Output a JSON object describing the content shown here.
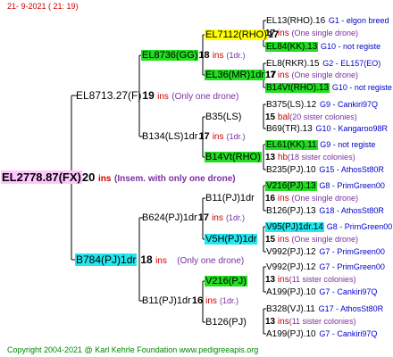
{
  "header": "21-  9-2021 ( 21: 19)",
  "copyright": "Copyright 2004-2021 @ Karl Kehrle Foundation    www.pedigreeapis.org",
  "colors": {
    "green": "#22dd22",
    "yellow": "#ffff00",
    "pink": "#ffc6ff",
    "cyan": "#22e6f0",
    "red": "#cc0000",
    "blue": "#0000cc",
    "purple": "#7b2fa0"
  },
  "root": {
    "name": "EL2778.87(FX)",
    "num": "20",
    "ins": "ins",
    "note": "(Insem. with only one drone)"
  },
  "parents": {
    "dam": {
      "name": "EL8713.27(F)",
      "num": "19",
      "ins": "ins",
      "note": "(Only one drone)"
    },
    "sire": {
      "name": "B784(PJ)1dr",
      "num": "18",
      "ins": "ins",
      "note": "(Only one drone)"
    }
  },
  "grandparents": [
    {
      "name": "EL8736(GG)",
      "num": "18",
      "ins": "ins",
      "note": "(1dr.)"
    },
    {
      "name": "B134(LS)1dr",
      "num": "17",
      "ins": "ins",
      "note": "(1dr.)"
    },
    {
      "name": "B624(PJ)1dr",
      "num": "17",
      "ins": "ins",
      "note": "(1dr.)"
    },
    {
      "name": "B11(PJ)1dr",
      "num": "16",
      "ins": "ins",
      "note": "(1dr.)"
    }
  ],
  "level3": [
    {
      "name": "EL7112(RHO)",
      "num": "17",
      "ins": "ins",
      "note": "(One single drone)"
    },
    {
      "name": "EL36(MR)1dr",
      "num": "17",
      "ins": "ins",
      "note": "(One single drone)"
    },
    {
      "name": "B35(LS)",
      "num": "",
      "ins": "",
      "note": ""
    },
    {
      "name": "B14Vt(RHO)",
      "num": "",
      "ins": "",
      "note": ""
    },
    {
      "name": "B11(PJ)1dr",
      "num": "",
      "ins": "",
      "note": ""
    },
    {
      "name": "V5H(PJ)1dr",
      "num": "",
      "ins": "",
      "note": ""
    },
    {
      "name": "V216(PJ)",
      "num": "",
      "ins": "",
      "note": ""
    },
    {
      "name": "B126(PJ)",
      "num": "",
      "ins": "",
      "note": ""
    }
  ],
  "level4": [
    {
      "name": "EL13(RHO).16",
      "ped": "G1 - elgon breed",
      "num": "",
      "ins": "",
      "note": ""
    },
    {
      "name": "",
      "ped": "",
      "num": "17",
      "ins": "ins",
      "note": "(One single drone)"
    },
    {
      "name": "EL84(KK).13",
      "ped": "G10 - not registe",
      "num": "",
      "ins": "",
      "note": ""
    },
    {
      "name": "EL8(RKR).15",
      "ped": "G2 - EL157(EO)",
      "num": "",
      "ins": "",
      "note": ""
    },
    {
      "name": "",
      "ped": "",
      "num": "17",
      "ins": "ins",
      "note": "(One single drone)"
    },
    {
      "name": "B14Vt(RHO).13",
      "ped": "G10 - not registe",
      "num": "",
      "ins": "",
      "note": ""
    },
    {
      "name": "B375(LS).12",
      "ped": "G9 - Cankiri97Q",
      "num": "",
      "ins": "",
      "note": ""
    },
    {
      "name": "",
      "ped": "",
      "num": "15",
      "ins": "bal",
      "note": "(20 sister colonies)"
    },
    {
      "name": "B69(TR).13",
      "ped": "G10 - Kangaroo98R",
      "num": "",
      "ins": "",
      "note": ""
    },
    {
      "name": "EL61(KK).11",
      "ped": "G9 - not registe",
      "num": "",
      "ins": "",
      "note": ""
    },
    {
      "name": "",
      "ped": "",
      "num": "13",
      "ins": "hb",
      "note": "(18 sister colonies)"
    },
    {
      "name": "B235(PJ).10",
      "ped": "G15 - AthosSt80R",
      "num": "",
      "ins": "",
      "note": ""
    },
    {
      "name": "V216(PJ).13",
      "ped": "G8 - PrimGreen00",
      "num": "",
      "ins": "",
      "note": ""
    },
    {
      "name": "",
      "ped": "",
      "num": "16",
      "ins": "ins",
      "note": "(One single drone)"
    },
    {
      "name": "B126(PJ).13",
      "ped": "G18 - AthosSt80R",
      "num": "",
      "ins": "",
      "note": ""
    },
    {
      "name": "V95(PJ)1dr.14",
      "ped": "G8 - PrimGreen00",
      "num": "",
      "ins": "",
      "note": ""
    },
    {
      "name": "",
      "ped": "",
      "num": "15",
      "ins": "ins",
      "note": "(One single drone)"
    },
    {
      "name": "V992(PJ).12",
      "ped": "G7 - PrimGreen00",
      "num": "",
      "ins": "",
      "note": ""
    },
    {
      "name": "V992(PJ).12",
      "ped": "G7 - PrimGreen00",
      "num": "",
      "ins": "",
      "note": ""
    },
    {
      "name": "",
      "ped": "",
      "num": "13",
      "ins": "ins",
      "note": "(11 sister colonies)"
    },
    {
      "name": "A199(PJ).10",
      "ped": "G7 - Cankiri97Q",
      "num": "",
      "ins": "",
      "note": ""
    },
    {
      "name": "B328(VJ).11",
      "ped": "G17 - AthosSt80R",
      "num": "",
      "ins": "",
      "note": ""
    },
    {
      "name": "",
      "ped": "",
      "num": "13",
      "ins": "ins",
      "note": "(11 sister colonies)"
    },
    {
      "name": "A199(PJ).10",
      "ped": "G7 - Cankiri97Q",
      "num": "",
      "ins": "",
      "note": ""
    }
  ]
}
